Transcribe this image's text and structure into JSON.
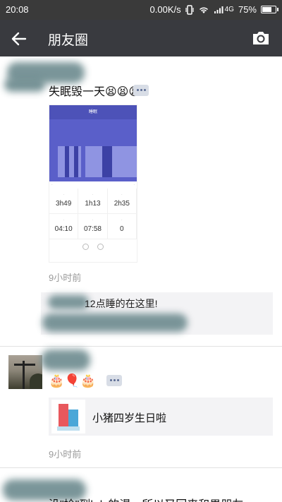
{
  "status_bar": {
    "time": "20:08",
    "network_speed": "0.00K/s",
    "signal_type": "4G",
    "battery_percent": "75%",
    "battery_level": 0.75,
    "icons": [
      "vibrate-icon",
      "wifi-icon",
      "cell-signal-icon",
      "battery-icon"
    ]
  },
  "nav": {
    "title": "朋友圈",
    "back_icon": "arrow-left-icon",
    "camera_icon": "camera-icon"
  },
  "posts": [
    {
      "text": "失眠毁一天😫😫😫",
      "image": {
        "header_title": "睡眠",
        "stats": [
          {
            "value": "3h49"
          },
          {
            "value": "1h13"
          },
          {
            "value": "2h35"
          },
          {
            "value": "04:10"
          },
          {
            "value": "07:58"
          },
          {
            "value": "0"
          }
        ]
      },
      "time": "9小时前",
      "comment": "12点睡的在这里!"
    },
    {
      "text": "🎂🎈🎂",
      "link_title": "小猪四岁生日啦",
      "time": "9小时前"
    },
    {
      "text": "没\"捡\"到kdc的漫，所以又回来和男朋友"
    }
  ],
  "colors": {
    "nav_bg": "#393a3f",
    "status_bg": "#3a3a3a",
    "sleep_chart": "#5a5fc9"
  }
}
